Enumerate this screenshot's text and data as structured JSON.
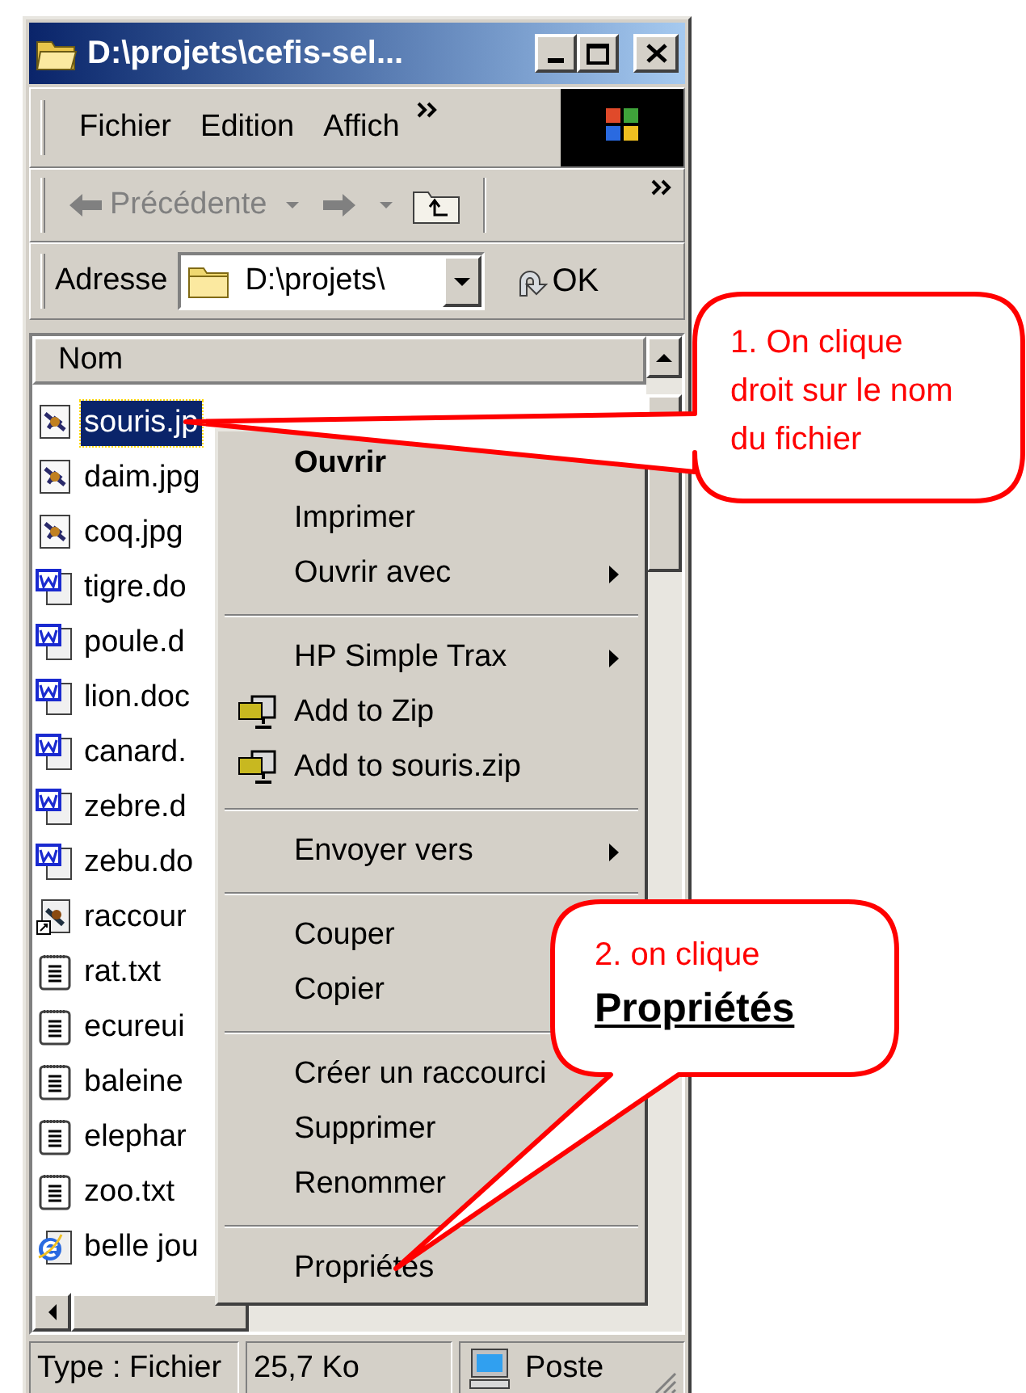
{
  "window": {
    "title": "D:\\projets\\cefis-sel..."
  },
  "menu_bar": {
    "items": [
      "Fichier",
      "Edition",
      "Affich"
    ]
  },
  "toolbar": {
    "back_label": "Précédente",
    "back_disabled": true
  },
  "address_bar": {
    "label": "Adresse",
    "value": "D:\\projets\\",
    "go_label": "OK"
  },
  "file_list": {
    "column": "Nom",
    "rows": [
      {
        "name": "souris.jp",
        "kind": "image",
        "selected": true
      },
      {
        "name": "daim.jpg",
        "kind": "image",
        "selected": false
      },
      {
        "name": "coq.jpg",
        "kind": "image",
        "selected": false
      },
      {
        "name": "tigre.do",
        "kind": "word",
        "selected": false
      },
      {
        "name": "poule.d",
        "kind": "word",
        "selected": false
      },
      {
        "name": "lion.doc",
        "kind": "word",
        "selected": false
      },
      {
        "name": "canard.",
        "kind": "word",
        "selected": false
      },
      {
        "name": "zebre.d",
        "kind": "word",
        "selected": false
      },
      {
        "name": "zebu.do",
        "kind": "word",
        "selected": false
      },
      {
        "name": "raccour",
        "kind": "shortcut",
        "selected": false
      },
      {
        "name": "rat.txt",
        "kind": "text",
        "selected": false
      },
      {
        "name": "ecureui",
        "kind": "text",
        "selected": false
      },
      {
        "name": "baleine",
        "kind": "text",
        "selected": false
      },
      {
        "name": "elephar",
        "kind": "text",
        "selected": false
      },
      {
        "name": "zoo.txt",
        "kind": "text",
        "selected": false
      },
      {
        "name": "belle jou",
        "kind": "web",
        "selected": false
      }
    ]
  },
  "context_menu": {
    "items": [
      {
        "kind": "item",
        "label": "Ouvrir",
        "default": true,
        "submenu": false,
        "icon": false
      },
      {
        "kind": "item",
        "label": "Imprimer",
        "default": false,
        "submenu": false,
        "icon": false
      },
      {
        "kind": "item",
        "label": "Ouvrir avec",
        "default": false,
        "submenu": true,
        "icon": false
      },
      {
        "kind": "separator"
      },
      {
        "kind": "item",
        "label": "HP Simple Trax",
        "default": false,
        "submenu": true,
        "icon": false
      },
      {
        "kind": "item",
        "label": "Add to Zip",
        "default": false,
        "submenu": false,
        "icon": true
      },
      {
        "kind": "item",
        "label": "Add to souris.zip",
        "default": false,
        "submenu": false,
        "icon": true
      },
      {
        "kind": "separator"
      },
      {
        "kind": "item",
        "label": "Envoyer vers",
        "default": false,
        "submenu": true,
        "icon": false
      },
      {
        "kind": "separator"
      },
      {
        "kind": "item",
        "label": "Couper",
        "default": false,
        "submenu": false,
        "icon": false
      },
      {
        "kind": "item",
        "label": "Copier",
        "default": false,
        "submenu": false,
        "icon": false
      },
      {
        "kind": "separator"
      },
      {
        "kind": "item",
        "label": "Créer un raccourci",
        "default": false,
        "submenu": false,
        "icon": false
      },
      {
        "kind": "item",
        "label": "Supprimer",
        "default": false,
        "submenu": false,
        "icon": false
      },
      {
        "kind": "item",
        "label": "Renommer",
        "default": false,
        "submenu": false,
        "icon": false
      },
      {
        "kind": "separator"
      },
      {
        "kind": "item",
        "label": "Propriétés",
        "default": false,
        "submenu": false,
        "icon": false
      }
    ]
  },
  "status_bar": [
    "Type : Fichier",
    "25,7 Ko",
    "Poste"
  ],
  "callouts": [
    {
      "text": "1. On clique\ndroit sur le nom\ndu fichier"
    },
    {
      "text": "2. on clique",
      "emphasis": "Propriétés"
    }
  ]
}
